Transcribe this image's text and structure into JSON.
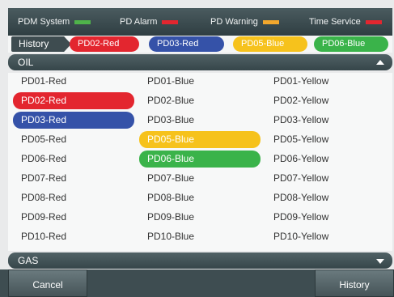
{
  "status": [
    {
      "label": "PDM System",
      "color": "#4fb34a"
    },
    {
      "label": "PD Alarm",
      "color": "#e3262f"
    },
    {
      "label": "PD Warning",
      "color": "#f2a72d"
    },
    {
      "label": "Time Service",
      "color": "#e3262f"
    }
  ],
  "history": {
    "label": "History",
    "chips": [
      {
        "label": "PD02-Red",
        "color": "#e3262f",
        "text_color": "#ffffff"
      },
      {
        "label": "PD03-Red",
        "color": "#3552a8",
        "text_color": "#ffffff"
      },
      {
        "label": "PD05-Blue",
        "color": "#f6c21c",
        "text_color": "#ffffff"
      },
      {
        "label": "PD06-Blue",
        "color": "#3ab34a",
        "text_color": "#ffffff"
      }
    ]
  },
  "oil": {
    "title": "OIL",
    "columns": [
      [
        "PD01-Red",
        "PD02-Red",
        "PD03-Red",
        "PD05-Red",
        "PD06-Red",
        "PD07-Red",
        "PD08-Red",
        "PD09-Red",
        "PD10-Red"
      ],
      [
        "PD01-Blue",
        "PD02-Blue",
        "PD03-Blue",
        "PD05-Blue",
        "PD06-Blue",
        "PD07-Blue",
        "PD08-Blue",
        "PD09-Blue",
        "PD10-Blue"
      ],
      [
        "PD01-Yellow",
        "PD02-Yellow",
        "PD03-Yellow",
        "PD05-Yellow",
        "PD06-Yellow",
        "PD07-Yellow",
        "PD08-Yellow",
        "PD09-Yellow",
        "PD10-Yellow"
      ]
    ],
    "selected": [
      {
        "col": 0,
        "row": 1,
        "color": "#e3262f"
      },
      {
        "col": 0,
        "row": 2,
        "color": "#3552a8"
      },
      {
        "col": 1,
        "row": 3,
        "color": "#f6c21c"
      },
      {
        "col": 1,
        "row": 4,
        "color": "#3ab34a"
      }
    ]
  },
  "gas": {
    "title": "GAS"
  },
  "footer": {
    "cancel_label": "Cancel",
    "history_label": "History"
  }
}
